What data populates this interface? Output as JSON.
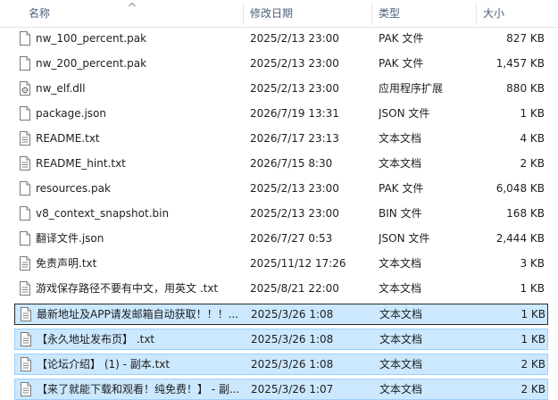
{
  "columns": {
    "name": "名称",
    "modified": "修改日期",
    "type": "类型",
    "size": "大小"
  },
  "files": [
    {
      "name": "nw_100_percent.pak",
      "modified": "2025/2/13 23:00",
      "type": "PAK 文件",
      "size": "827 KB",
      "icon": "blank-file-icon",
      "selected": false
    },
    {
      "name": "nw_200_percent.pak",
      "modified": "2025/2/13 23:00",
      "type": "PAK 文件",
      "size": "1,457 KB",
      "icon": "blank-file-icon",
      "selected": false
    },
    {
      "name": "nw_elf.dll",
      "modified": "2025/2/13 23:00",
      "type": "应用程序扩展",
      "size": "880 KB",
      "icon": "dll-file-icon",
      "selected": false
    },
    {
      "name": "package.json",
      "modified": "2026/7/19 13:31",
      "type": "JSON 文件",
      "size": "1 KB",
      "icon": "blank-file-icon",
      "selected": false
    },
    {
      "name": "README.txt",
      "modified": "2026/7/17 23:13",
      "type": "文本文档",
      "size": "4 KB",
      "icon": "text-file-icon",
      "selected": false
    },
    {
      "name": "README_hint.txt",
      "modified": "2026/7/15 8:30",
      "type": "文本文档",
      "size": "2 KB",
      "icon": "text-file-icon",
      "selected": false
    },
    {
      "name": "resources.pak",
      "modified": "2025/2/13 23:00",
      "type": "PAK 文件",
      "size": "6,048 KB",
      "icon": "blank-file-icon",
      "selected": false
    },
    {
      "name": "v8_context_snapshot.bin",
      "modified": "2025/2/13 23:00",
      "type": "BIN 文件",
      "size": "168 KB",
      "icon": "blank-file-icon",
      "selected": false
    },
    {
      "name": "翻译文件.json",
      "modified": "2026/7/27 0:53",
      "type": "JSON 文件",
      "size": "2,444 KB",
      "icon": "blank-file-icon",
      "selected": false
    },
    {
      "name": "免责声明.txt",
      "modified": "2025/11/12 17:26",
      "type": "文本文档",
      "size": "3 KB",
      "icon": "text-file-icon",
      "selected": false
    },
    {
      "name": "游戏保存路径不要有中文，用英文 .txt",
      "modified": "2025/8/21 22:00",
      "type": "文本文档",
      "size": "1 KB",
      "icon": "text-file-icon",
      "selected": false
    },
    {
      "name": "最新地址及APP请发邮箱自动获取！！！...",
      "modified": "2025/3/26 1:08",
      "type": "文本文档",
      "size": "1 KB",
      "icon": "text-file-icon",
      "selected": true
    },
    {
      "name": "【永久地址发布页】 .txt",
      "modified": "2025/3/26 1:08",
      "type": "文本文档",
      "size": "1 KB",
      "icon": "text-file-icon",
      "selected": true
    },
    {
      "name": "【论坛介绍】 (1) - 副本.txt",
      "modified": "2025/3/26 1:08",
      "type": "文本文档",
      "size": "2 KB",
      "icon": "text-file-icon",
      "selected": true
    },
    {
      "name": "【来了就能下载和观看！纯免费！】 - 副...",
      "modified": "2025/3/26 1:07",
      "type": "文本文档",
      "size": "2 KB",
      "icon": "text-file-icon",
      "selected": true
    }
  ]
}
